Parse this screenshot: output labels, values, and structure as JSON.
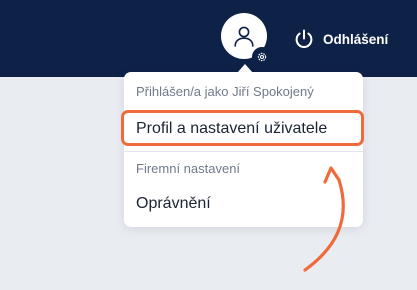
{
  "header": {
    "logout_label": "Odhlášení",
    "avatar_icon": "user-icon",
    "settings_badge_icon": "gear-icon",
    "logout_icon": "power-icon"
  },
  "user_menu": {
    "signed_in_as": "Přihlášen/a jako Jiří Spokojený",
    "profile_settings": "Profil a nastavení uživatele",
    "company_settings_heading": "Firemní nastavení",
    "permissions": "Oprávnění"
  },
  "annotation": {
    "highlight_color": "#ef6b3b",
    "arrow_icon": "curved-arrow-icon"
  },
  "colors": {
    "header_bg": "#0e2146",
    "page_bg": "#e9ecf1",
    "accent": "#ef6b3b"
  }
}
